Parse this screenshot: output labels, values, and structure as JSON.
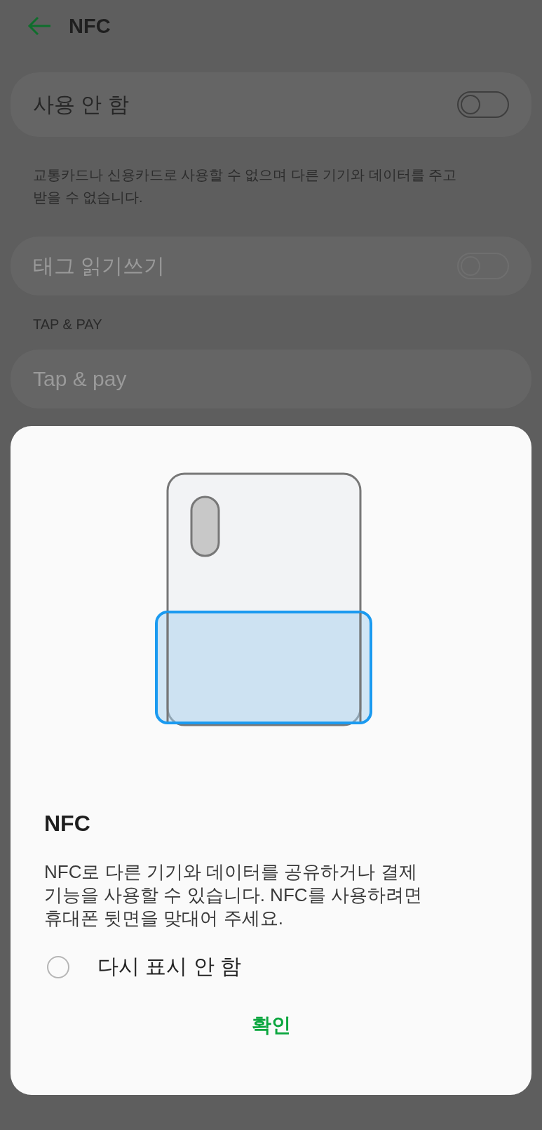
{
  "header": {
    "title": "NFC"
  },
  "nfc_toggle": {
    "label": "사용 안 함",
    "on": false
  },
  "description": "교통카드나 신용카드로 사용할 수 없으며 다른 기기와 데이터를 주고 받을 수 없습니다.",
  "tag_rw": {
    "label": "태그 읽기쓰기",
    "on": false,
    "disabled": true
  },
  "section_header": "TAP & PAY",
  "tap_pay": {
    "label": "Tap & pay",
    "disabled": true
  },
  "dialog": {
    "title": "NFC",
    "message": "NFC로 다른 기기와 데이터를 공유하거나 결제 기능을 사용할 수 있습니다. NFC를 사용하려면 휴대폰 뒷면을 맞대어 주세요.",
    "dont_show_again": {
      "label": "다시 표시 안 함",
      "checked": false
    },
    "confirm_button": "확인"
  }
}
